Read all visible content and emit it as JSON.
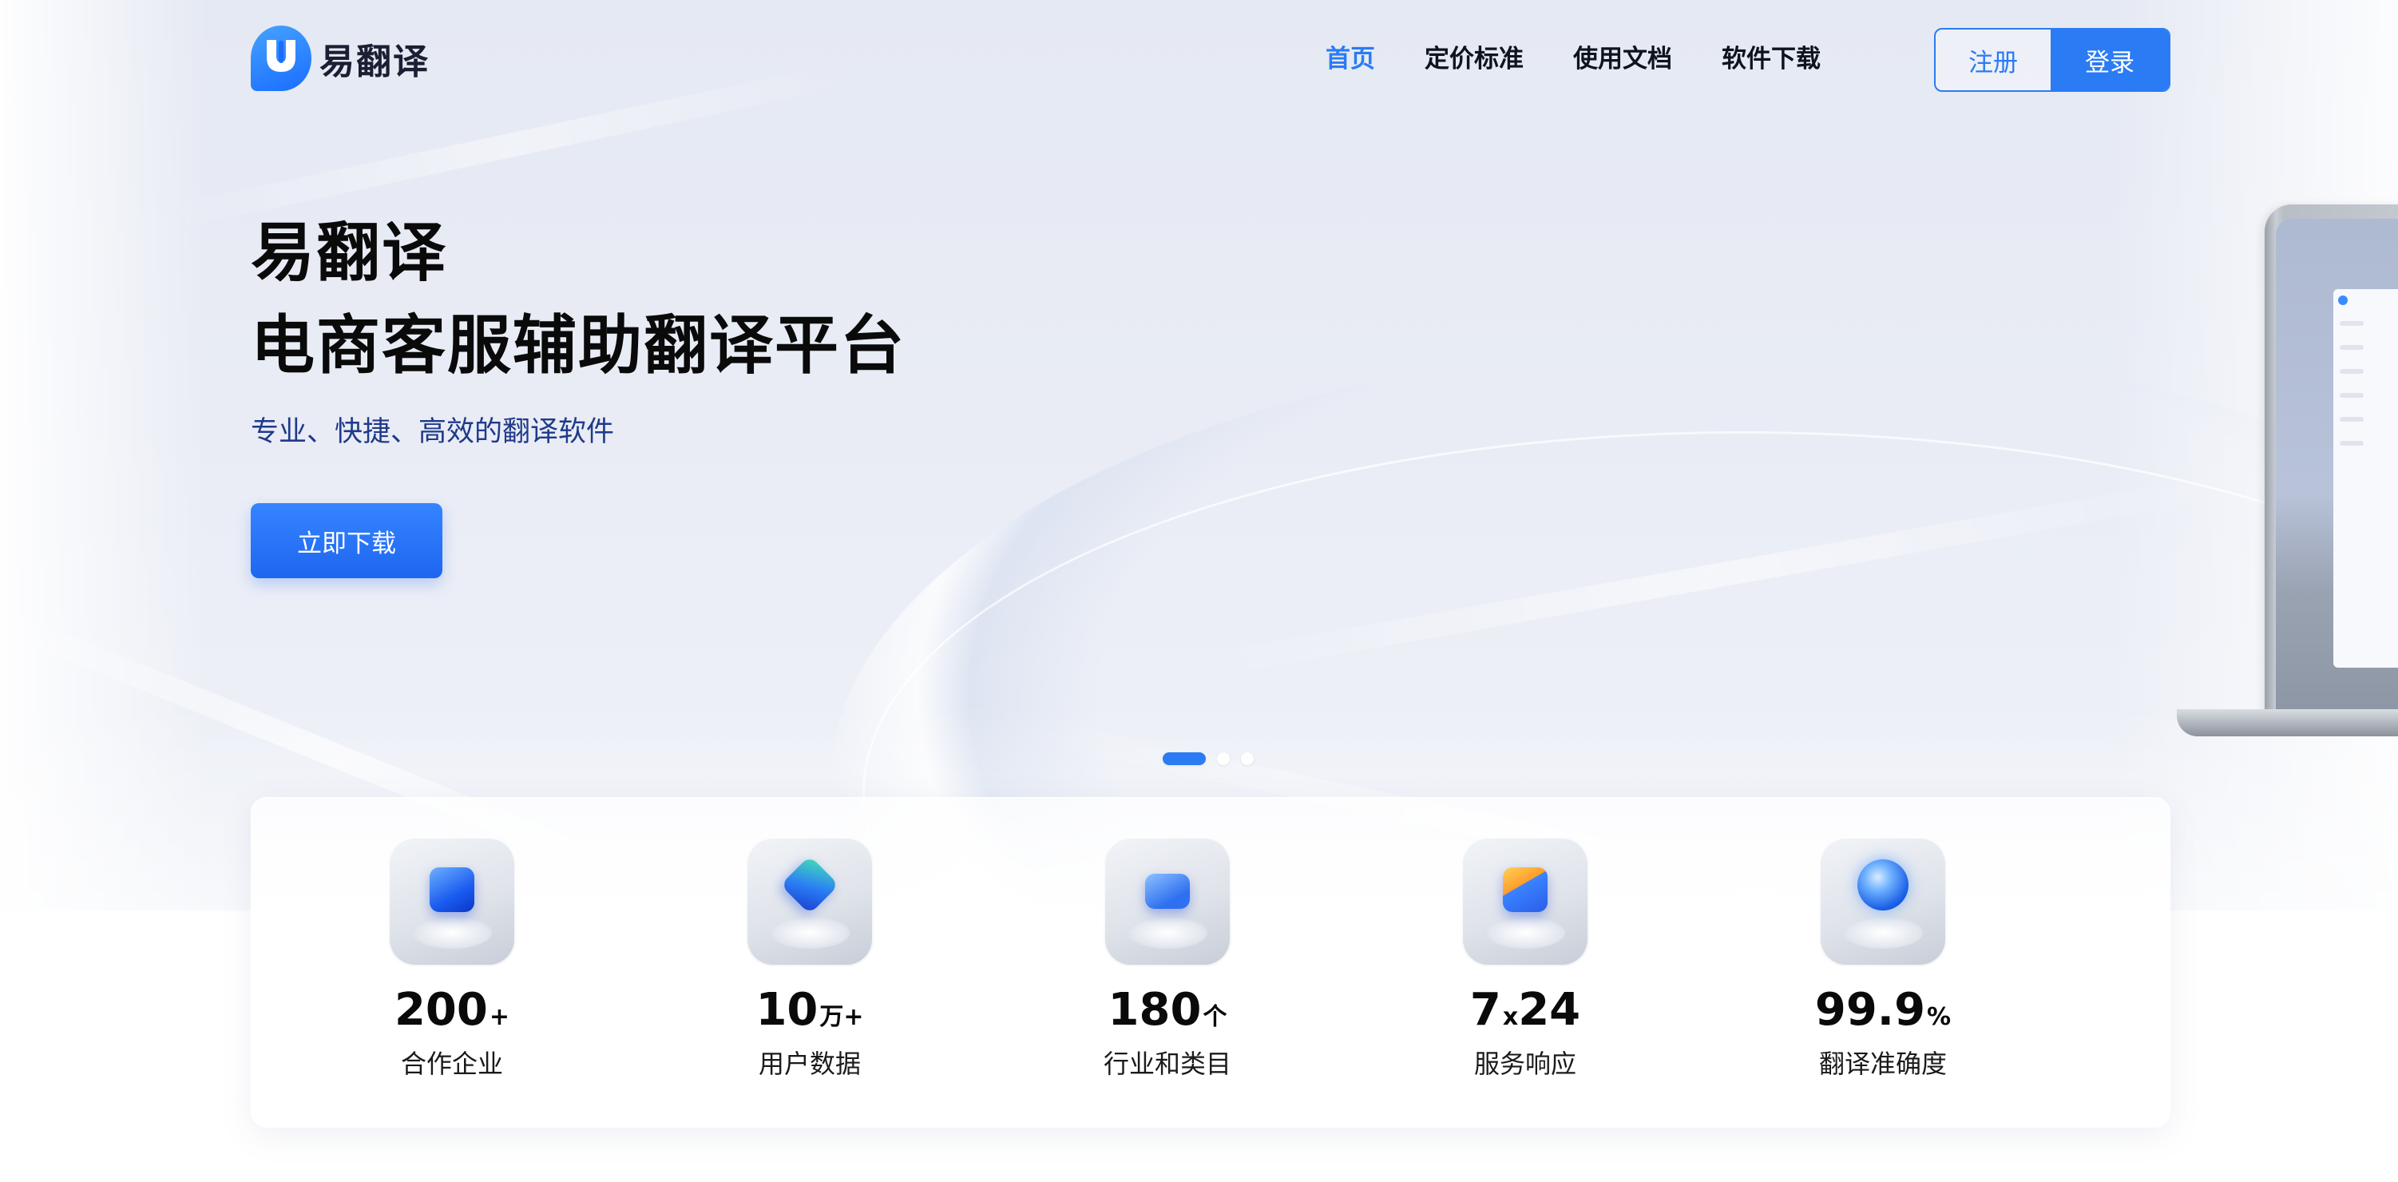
{
  "header": {
    "logo_text": "易翻译",
    "nav": [
      {
        "label": "首页",
        "active": true
      },
      {
        "label": "定价标准",
        "active": false
      },
      {
        "label": "使用文档",
        "active": false
      },
      {
        "label": "软件下载",
        "active": false
      }
    ],
    "register_label": "注册",
    "login_label": "登录"
  },
  "hero": {
    "title_line1": "易翻译",
    "title_line2": "电商客服辅助翻译平台",
    "subtitle": "专业、快捷、高效的翻译软件",
    "cta_label": "立即下载",
    "carousel": {
      "count": 3,
      "active_index": 0
    }
  },
  "stats": [
    {
      "value": "200",
      "unit": "+",
      "label": "合作企业",
      "icon": "cube-icon"
    },
    {
      "value": "10",
      "unit": "万+",
      "label": "用户数据",
      "icon": "layers-icon"
    },
    {
      "value": "180",
      "unit": "个",
      "label": "行业和类目",
      "icon": "tray-icon"
    },
    {
      "value": "7",
      "unit": "x",
      "value2": "24",
      "label": "服务响应",
      "icon": "service-icon"
    },
    {
      "value": "99.9",
      "unit": "%",
      "label": "翻译准确度",
      "icon": "globe-icon"
    }
  ],
  "colors": {
    "accent": "#2a7bf4",
    "title": "#0a0a0a",
    "subtitle": "#1f3a8a"
  }
}
